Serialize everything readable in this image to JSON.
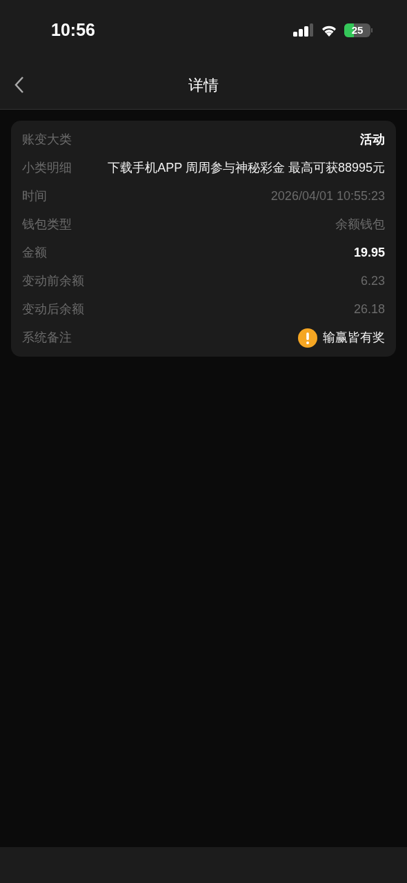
{
  "status_bar": {
    "time": "10:56",
    "battery": "25"
  },
  "nav": {
    "title": "详情"
  },
  "details": [
    {
      "label": "账变大类",
      "value": "活动",
      "kind": "emphasis"
    },
    {
      "label": "小类明细",
      "value": "下载手机APP 周周参与神秘彩金 最高可获88995元",
      "kind": "plain"
    },
    {
      "label": "时间",
      "value": "2026/04/01 10:55:23",
      "kind": "muted"
    },
    {
      "label": "钱包类型",
      "value": "余额钱包",
      "kind": "muted"
    },
    {
      "label": "金额",
      "value": "19.95",
      "kind": "emphasis"
    },
    {
      "label": "变动前余额",
      "value": "6.23",
      "kind": "muted"
    },
    {
      "label": "变动后余额",
      "value": "26.18",
      "kind": "muted"
    },
    {
      "label": "系统备注",
      "value": "输赢皆有奖",
      "kind": "note"
    }
  ]
}
